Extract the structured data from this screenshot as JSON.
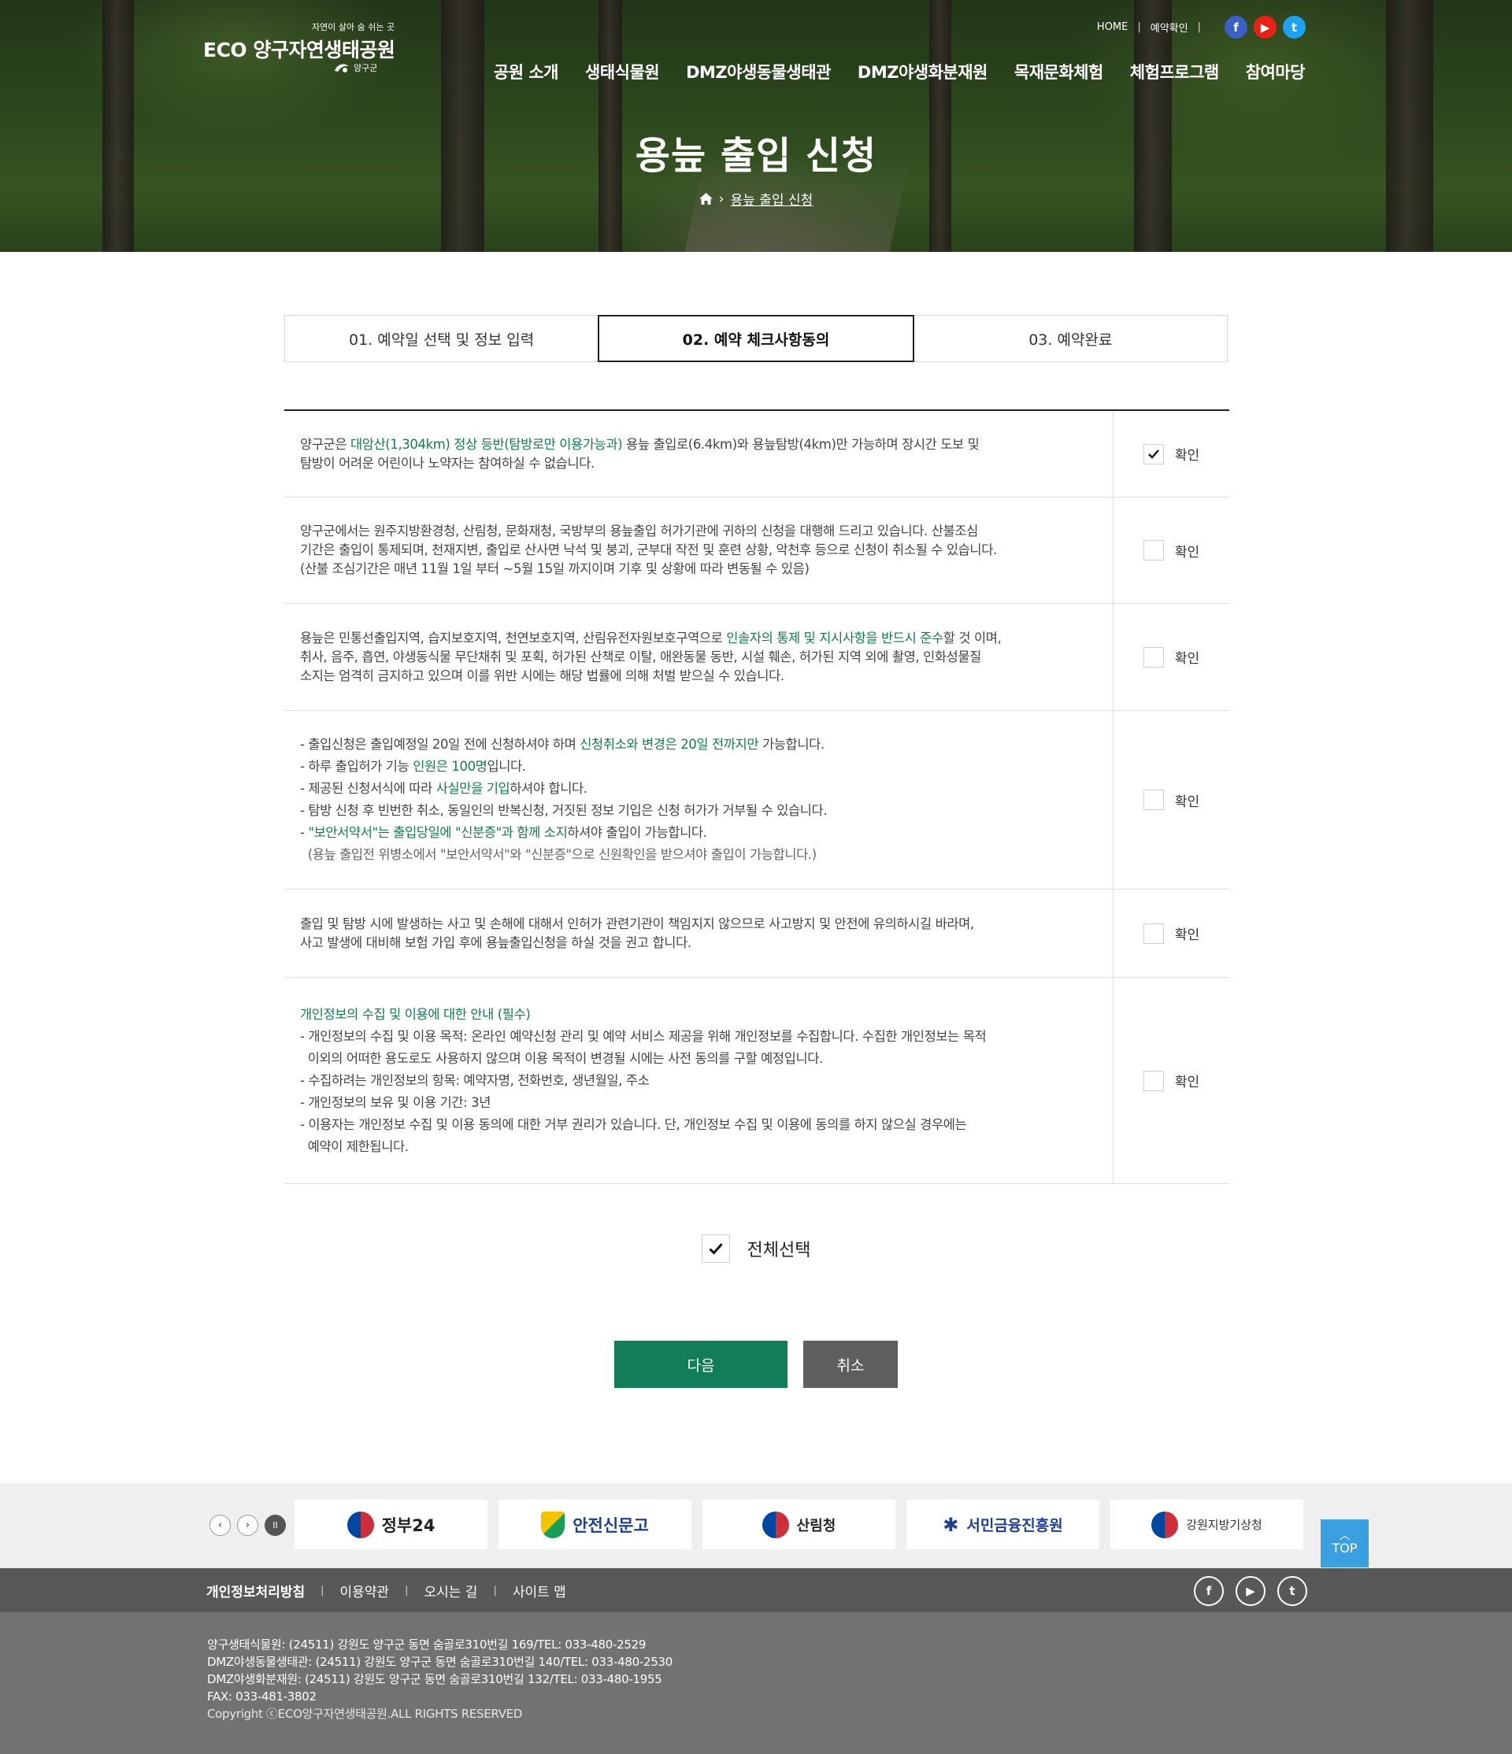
{
  "header": {
    "logo_tagline": "자연이 살아 숨 쉬는 곳",
    "logo_name": "ECO 양구자연생태공원",
    "logo_gun": "양구군",
    "util_links": [
      "HOME",
      "예약확인"
    ],
    "social": [
      "f",
      "▶",
      "t"
    ],
    "gnb": [
      "공원 소개",
      "생태식물원",
      "DMZ야생동물생태관",
      "DMZ야생화분재원",
      "목재문화체험",
      "체험프로그램",
      "참여마당"
    ]
  },
  "hero": {
    "title": "용늪 출입 신청",
    "breadcrumb_current": "용늪 출입 신청"
  },
  "steps": [
    {
      "label": "01. 예약일 선택 및 정보 입력",
      "active": false
    },
    {
      "label": "02. 예약 체크사항동의",
      "active": true
    },
    {
      "label": "03. 예약완료",
      "active": false
    }
  ],
  "terms": {
    "confirm_label": "확인",
    "rows": [
      {
        "checked": true,
        "lines": [
          [
            {
              "t": "양구군은 "
            },
            {
              "t": "대암산(1,304km) 정상 등반(탐방로만 이용가능과)",
              "g": true
            },
            {
              "t": " 용늪 출입로(6.4km)와 용늪탐방(4km)만 가능하며 장시간 도보 및"
            }
          ],
          [
            {
              "t": "탐방이 어려운 어린이나 노약자는 참여하실 수 없습니다."
            }
          ]
        ]
      },
      {
        "checked": false,
        "lines": [
          [
            {
              "t": "양구군에서는 원주지방환경청, 산림청, 문화재청, 국방부의 용늪출입 허가기관에 귀하의 신청을 대행해 드리고 있습니다. 산불조심"
            }
          ],
          [
            {
              "t": "기간은 출입이 통제되며, 천재지변, 출입로 산사면 낙석 및 붕괴, 군부대 작전 및 훈련 상황, 악천후 등으로 신청이 취소될 수 있습니다."
            }
          ],
          [
            {
              "t": "(산불 조심기간은 매년 11월 1일 부터 ~5월 15일 까지이며 기후 및 상황에 따라 변동될 수 있음)"
            }
          ]
        ]
      },
      {
        "checked": false,
        "lines": [
          [
            {
              "t": "용늪은 민통선출입지역, 습지보호지역, 천연보호지역, 산림유전자원보호구역으로 "
            },
            {
              "t": "인솔자의 통제 및 지시사항을 반드시 준수",
              "g": true
            },
            {
              "t": "할 것 이며,"
            }
          ],
          [
            {
              "t": "취사, 음주, 흡연, 야생동식물 무단채취 및 포획, 허가된 산책로 이탈, 애완동물 동반, 시설 훼손, 허가된 지역 외에 촬영, 인화성물질"
            }
          ],
          [
            {
              "t": "소지는 엄격히 금지하고 있으며 이를 위반 시에는 해당 법률에 의해 처벌 받으실 수 있습니다."
            }
          ]
        ]
      },
      {
        "checked": false,
        "lines": [
          [
            {
              "t": "- 출입신청은 출입예정일 20일 전에 신청하셔야 하며 "
            },
            {
              "t": "신청취소와 변경은 20일 전까지만",
              "g": true
            },
            {
              "t": " 가능합니다."
            }
          ],
          [
            {
              "t": "- 하루 출입허가 기능 "
            },
            {
              "t": "인원은 100명",
              "g": true
            },
            {
              "t": "입니다."
            }
          ],
          [
            {
              "t": "- 제공된 신청서식에 따라 "
            },
            {
              "t": "사실만을 기입",
              "g": true
            },
            {
              "t": "하셔야 합니다."
            }
          ],
          [
            {
              "t": "- 탐방 신청 후 빈번한 취소, 동일인의 반복신청, 거짓된 정보 기입은 신청 허가가 거부될 수 있습니다."
            }
          ],
          [
            {
              "t": "- "
            },
            {
              "t": "\"보안서약서\"는 출입당일에 \"신분증\"과 함께 소지",
              "g": true
            },
            {
              "t": "하셔야 출입이 가능합니다."
            }
          ],
          [
            {
              "t": "  (용늪 출입전 위병소에서 \"보안서약서\"와 \"신분증\"으로 신원확인을 받으셔야 출입이 가능합니다.)",
              "m": true
            }
          ]
        ]
      },
      {
        "checked": false,
        "lines": [
          [
            {
              "t": "출입 및 탐방 시에 발생하는 사고 및 손해에 대해서 인허가 관련기관이 책임지지 않으므로 사고방지 및 안전에 유의하시길 바라며,"
            }
          ],
          [
            {
              "t": "사고 발생에 대비해 보험 가입 후에 용늪출입신청을 하실 것을 권고 합니다."
            }
          ]
        ]
      },
      {
        "checked": false,
        "lines": [
          [
            {
              "t": "개인정보의 수집 및 이용에 대한 안내 (필수)",
              "g": true
            }
          ],
          [
            {
              "t": "- 개인정보의 수집 및 이용 목적: 온라인 예약신청 관리 및 예약 서비스 제공을 위해 개인정보를 수집합니다. 수집한 개인정보는 목적"
            }
          ],
          [
            {
              "t": "  이외의 어떠한 용도로도 사용하지 않으며 이용 목적이 변경될 시에는 사전 동의를 구할 예정입니다."
            }
          ],
          [
            {
              "t": "- 수집하려는 개인정보의 항목: 예약자명, 전화번호, 생년월일, 주소"
            }
          ],
          [
            {
              "t": "- 개인정보의 보유 및 이용 기간: 3년"
            }
          ],
          [
            {
              "t": "- 이용자는 개인정보 수집 및 이용 동의에 대한 거부 권리가 있습니다. 단, 개인정보 수집 및 이용에 동의를 하지 않으실 경우에는"
            }
          ],
          [
            {
              "t": "  예약이 제한됩니다."
            }
          ]
        ]
      }
    ]
  },
  "select_all": {
    "label": "전체선택",
    "checked": true
  },
  "buttons": {
    "next": "다음",
    "cancel": "취소"
  },
  "family_sites": {
    "controls": [
      "‹",
      "›",
      "II"
    ],
    "banners": [
      "정부24",
      "안전신문고",
      "산림청",
      "서민금융진흥원",
      "강원지방기상청"
    ]
  },
  "top_button": "TOP",
  "footer": {
    "links": [
      "개인정보처리방침",
      "이용약관",
      "오시는 길",
      "사이트 맵"
    ],
    "social": [
      "f",
      "▶",
      "t"
    ],
    "address_lines": [
      "양구생태식물원: (24511) 강원도 양구군 동면 숨골로310번길 169/TEL: 033-480-2529",
      "DMZ야생동물생태관: (24511) 강원도 양구군 동면 숨골로310번길 140/TEL: 033-480-2530",
      "DMZ야생화분재원: (24511) 강원도 양구군 동면 숨골로310번길 132/TEL: 033-480-1955",
      "FAX: 033-481-3802"
    ],
    "copyright": "Copyright ⓒECO양구자연생태공원.ALL RIGHTS RESERVED"
  },
  "colors": {
    "accent_green": "#157b4f",
    "next_button": "#127e57",
    "cancel_button": "#5e5e5e",
    "top_button": "#3aa0e0"
  }
}
